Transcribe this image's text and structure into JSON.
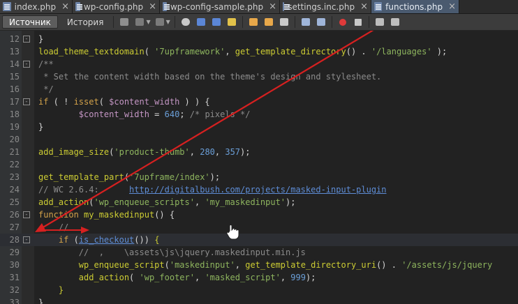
{
  "tabs": [
    {
      "label": "index.php",
      "close": "×",
      "active": false
    },
    {
      "label": "wp-config.php",
      "close": "×",
      "active": false
    },
    {
      "label": "wp-config-sample.php",
      "close": "×",
      "active": false
    },
    {
      "label": "settings.inc.php",
      "close": "×",
      "active": false
    },
    {
      "label": "functions.php",
      "close": "×",
      "active": true
    }
  ],
  "toolbar": {
    "source_label": "Источник",
    "history_label": "История"
  },
  "colors": {
    "keyword": "#d4a34a",
    "function": "#cccc33",
    "string": "#8eb55e",
    "variable": "#c496c4",
    "number": "#6b9fd8",
    "comment": "#8c8c8c",
    "default": "#d6d6d6",
    "link": "#5e8dd6",
    "arrow": "#d62020"
  },
  "editor": {
    "lines": [
      {
        "n": "12",
        "fold": "-",
        "current": false,
        "tokens": [
          [
            "}",
            "default"
          ]
        ]
      },
      {
        "n": "13",
        "fold": "",
        "current": false,
        "tokens": [
          [
            "load_theme_textdomain",
            "function"
          ],
          [
            "( ",
            "default"
          ],
          [
            "'7upframework'",
            "string"
          ],
          [
            ", ",
            "default"
          ],
          [
            "get_template_directory",
            "function"
          ],
          [
            "() . ",
            "default"
          ],
          [
            "'/languages'",
            "string"
          ],
          [
            " );",
            "default"
          ]
        ]
      },
      {
        "n": "14",
        "fold": "-",
        "current": false,
        "tokens": [
          [
            "/**",
            "comment"
          ]
        ]
      },
      {
        "n": "15",
        "fold": "",
        "current": false,
        "tokens": [
          [
            " * Set the content width based on the theme's design and stylesheet.",
            "comment"
          ]
        ]
      },
      {
        "n": "16",
        "fold": "",
        "current": false,
        "tokens": [
          [
            " */",
            "comment"
          ]
        ]
      },
      {
        "n": "17",
        "fold": "-",
        "current": false,
        "tokens": [
          [
            "if",
            "keyword"
          ],
          [
            " ( ! ",
            "default"
          ],
          [
            "isset",
            "keyword"
          ],
          [
            "( ",
            "default"
          ],
          [
            "$content_width",
            "variable"
          ],
          [
            " ) ) {",
            "default"
          ]
        ]
      },
      {
        "n": "18",
        "fold": "",
        "current": false,
        "tokens": [
          [
            "        ",
            "default"
          ],
          [
            "$content_width",
            "variable"
          ],
          [
            " = ",
            "default"
          ],
          [
            "640",
            "number"
          ],
          [
            "; ",
            "default"
          ],
          [
            "/* pixels */",
            "comment"
          ]
        ]
      },
      {
        "n": "19",
        "fold": "",
        "current": false,
        "tokens": [
          [
            "}",
            "default"
          ]
        ]
      },
      {
        "n": "20",
        "fold": "",
        "current": false,
        "tokens": []
      },
      {
        "n": "21",
        "fold": "",
        "current": false,
        "tokens": [
          [
            "add_image_size",
            "function"
          ],
          [
            "(",
            "default"
          ],
          [
            "'product-thumb'",
            "string"
          ],
          [
            ", ",
            "default"
          ],
          [
            "280",
            "number"
          ],
          [
            ", ",
            "default"
          ],
          [
            "357",
            "number"
          ],
          [
            ");",
            "default"
          ]
        ]
      },
      {
        "n": "22",
        "fold": "",
        "current": false,
        "tokens": []
      },
      {
        "n": "23",
        "fold": "",
        "current": false,
        "tokens": [
          [
            "get_template_part",
            "function"
          ],
          [
            "(",
            "default"
          ],
          [
            "'7upframe/index'",
            "string"
          ],
          [
            ");",
            "default"
          ]
        ]
      },
      {
        "n": "24",
        "fold": "",
        "current": false,
        "tokens": [
          [
            "// WC 2.6.4:      ",
            "comment"
          ],
          [
            "http://digitalbush.com/projects/masked-input-plugin",
            "link"
          ]
        ]
      },
      {
        "n": "25",
        "fold": "",
        "current": false,
        "tokens": [
          [
            "add_action",
            "function"
          ],
          [
            "(",
            "default"
          ],
          [
            "'wp_enqueue_scripts'",
            "string"
          ],
          [
            ", ",
            "default"
          ],
          [
            "'my_maskedinput'",
            "string"
          ],
          [
            ");",
            "default"
          ]
        ]
      },
      {
        "n": "26",
        "fold": "-",
        "current": false,
        "tokens": [
          [
            "function",
            "keyword"
          ],
          [
            " ",
            "default"
          ],
          [
            "my_maskedinput",
            "function"
          ],
          [
            "() {",
            "default"
          ]
        ]
      },
      {
        "n": "27",
        "fold": "",
        "current": false,
        "tokens": [
          [
            "    //",
            "comment"
          ]
        ]
      },
      {
        "n": "28",
        "fold": "-",
        "current": true,
        "tokens": [
          [
            "    ",
            "default"
          ],
          [
            "if",
            "keyword"
          ],
          [
            " (",
            "default"
          ],
          [
            "is_checkout",
            "link"
          ],
          [
            "()) ",
            "default"
          ],
          [
            "{",
            "function"
          ]
        ]
      },
      {
        "n": "29",
        "fold": "",
        "current": false,
        "tokens": [
          [
            "        //  ,    \\assets\\js\\jquery.maskedinput.min.js",
            "comment"
          ]
        ]
      },
      {
        "n": "30",
        "fold": "",
        "current": false,
        "tokens": [
          [
            "        ",
            "default"
          ],
          [
            "wp_enqueue_script",
            "function"
          ],
          [
            "(",
            "default"
          ],
          [
            "'maskedinput'",
            "string"
          ],
          [
            ", ",
            "default"
          ],
          [
            "get_template_directory_uri",
            "function"
          ],
          [
            "() . ",
            "default"
          ],
          [
            "'/assets/js/jquery",
            "string"
          ]
        ]
      },
      {
        "n": "31",
        "fold": "",
        "current": false,
        "tokens": [
          [
            "        ",
            "default"
          ],
          [
            "add_action",
            "function"
          ],
          [
            "( ",
            "default"
          ],
          [
            "'wp_footer'",
            "string"
          ],
          [
            ", ",
            "default"
          ],
          [
            "'masked_script'",
            "string"
          ],
          [
            ", ",
            "default"
          ],
          [
            "999",
            "number"
          ],
          [
            ");",
            "default"
          ]
        ]
      },
      {
        "n": "32",
        "fold": "",
        "current": false,
        "tokens": [
          [
            "    ",
            "default"
          ],
          [
            "}",
            "function"
          ]
        ]
      },
      {
        "n": "33",
        "fold": "",
        "current": false,
        "tokens": [
          [
            "}",
            "default"
          ]
        ]
      }
    ]
  }
}
